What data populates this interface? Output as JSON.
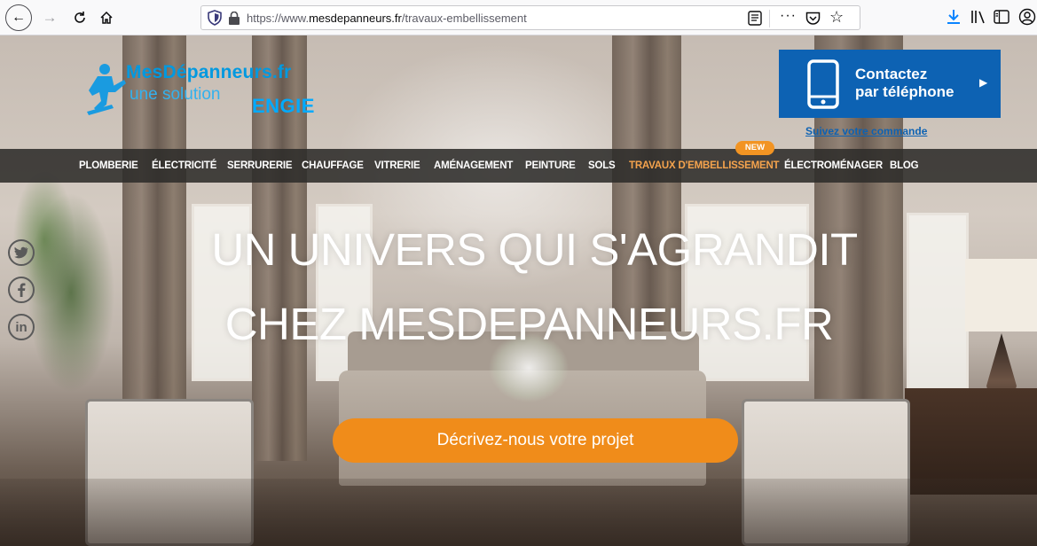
{
  "browser": {
    "url_prefix": "https://www.",
    "url_domain": "mesdepanneurs.fr",
    "url_path": "/travaux-embellissement",
    "more_label": "···"
  },
  "logo": {
    "brand": "MesDépanneurs.fr",
    "tagline": "une solution",
    "engie": "ENGIE"
  },
  "contact": {
    "line1": "Contactez",
    "line2": "par téléphone",
    "track_link": "Suivez votre commande"
  },
  "nav": {
    "items": [
      {
        "label": "PLOMBERIE"
      },
      {
        "label": "ÉLECTRICITÉ"
      },
      {
        "label": "SERRURERIE"
      },
      {
        "label": "CHAUFFAGE"
      },
      {
        "label": "VITRERIE"
      },
      {
        "label": "AMÉNAGEMENT"
      },
      {
        "label": "PEINTURE"
      },
      {
        "label": "SOLS"
      },
      {
        "label": "TRAVAUX D'EMBELLISSEMENT",
        "active": true
      },
      {
        "label": "ÉLECTROMÉNAGER"
      },
      {
        "label": "BLOG"
      }
    ],
    "new_badge": "NEW"
  },
  "social": {
    "linkedin_label": "in"
  },
  "hero": {
    "headline_line1": "UN UNIVERS QUI S'AGRANDIT",
    "headline_line2": "CHEZ MESDEPANNEURS.FR",
    "cta_label": "Décrivez-nous votre projet"
  },
  "colors": {
    "brand_blue": "#0099e0",
    "contact_blue": "#0d62b3",
    "nav_bg": "#2e2c2a",
    "accent_orange": "#f08c1a",
    "active_nav": "#f5a34d"
  },
  "icons": [
    "back-icon",
    "forward-icon",
    "reload-icon",
    "home-icon",
    "shield-icon",
    "lock-icon",
    "reader-view-icon",
    "pocket-icon",
    "bookmark-star-icon",
    "download-icon",
    "library-icon",
    "sidebar-icon",
    "account-icon",
    "phone-icon",
    "chevron-right-icon",
    "twitter-icon",
    "facebook-icon",
    "linkedin-icon"
  ]
}
